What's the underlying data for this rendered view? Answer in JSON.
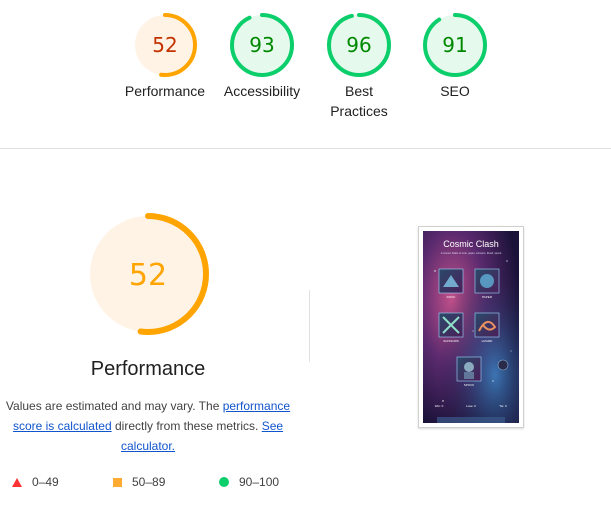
{
  "colors": {
    "orange": "#ffa400",
    "orange_text": "#c33300",
    "orange_bg": "#fff3e5",
    "green": "#0cce6b",
    "green_text": "#008800",
    "green_bg": "#e5f9ed",
    "gauge_track": "#e0e0e0",
    "red": "#ff3333",
    "link": "#1155cc"
  },
  "gauges": [
    {
      "label": "Performance",
      "score": "52",
      "value": 52,
      "rating": "average"
    },
    {
      "label": "Accessibility",
      "score": "93",
      "value": 93,
      "rating": "pass"
    },
    {
      "label": "Best Practices",
      "score": "96",
      "value": 96,
      "rating": "pass"
    },
    {
      "label": "SEO",
      "score": "91",
      "value": 91,
      "rating": "pass"
    }
  ],
  "performance": {
    "score": "52",
    "value": 52,
    "title": "Performance",
    "desc_before": "Values are estimated and may vary. The ",
    "link_calc": "performance score is calculated",
    "desc_middle": " directly from these metrics. ",
    "link_calculator": "See calculator."
  },
  "legend": [
    {
      "icon": "triangle",
      "range": "0–49"
    },
    {
      "icon": "square",
      "range": "50–89"
    },
    {
      "icon": "circle",
      "range": "90–100"
    }
  ],
  "screenshot": {
    "app_title": "Cosmic Clash",
    "subtitle": "A cosmic battle of rock, paper, scissors, lizard, spock",
    "choices": [
      "ROCK",
      "PAPER",
      "SCISSORS",
      "LIZARD",
      "SPOCK"
    ],
    "footer": [
      "Win: 0",
      "Lose: 0",
      "Tie: 0"
    ]
  }
}
